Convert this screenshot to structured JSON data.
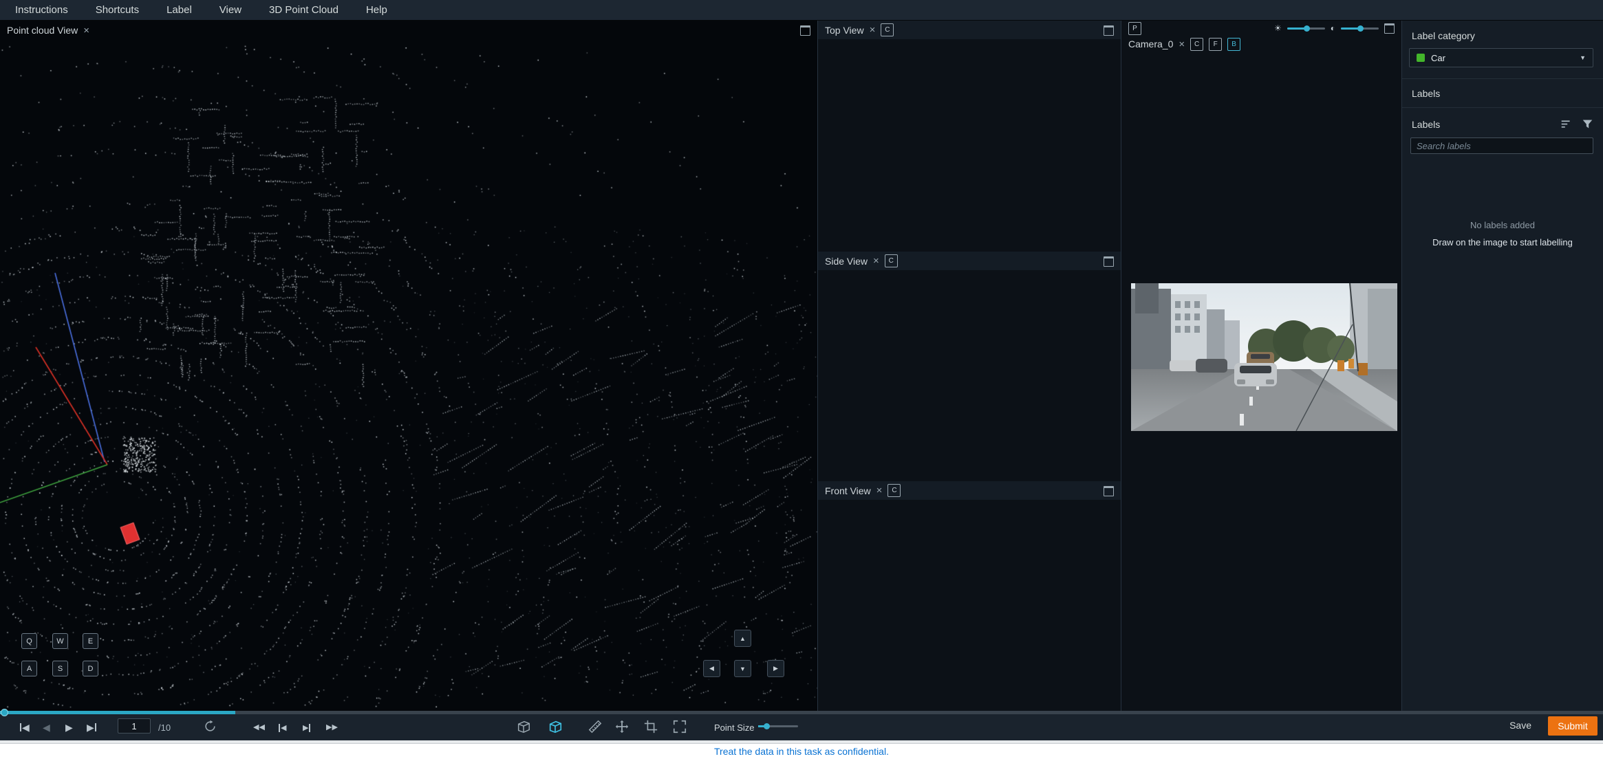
{
  "colors": {
    "accent_teal": "#36b1cf",
    "submit_orange": "#ec7211",
    "category_green": "#43b62b",
    "banner_blue": "#0972d3",
    "cuboid_red": "#e03131"
  },
  "menu": {
    "items": [
      "Instructions",
      "Shortcuts",
      "Label",
      "View",
      "3D Point Cloud",
      "Help"
    ]
  },
  "glyphs": {
    "close": "×",
    "caret_down": "▼",
    "play": "▶",
    "back": "◀",
    "forward": "▶",
    "up": "▲",
    "down": "▼",
    "left": "◀",
    "right": "▶",
    "brightness": "☀",
    "contrast": "◐"
  },
  "panels": {
    "point_cloud": {
      "title": "Point cloud View"
    },
    "top_view": {
      "title": "Top View",
      "camera_button": "C"
    },
    "side_view": {
      "title": "Side View",
      "camera_button": "C"
    },
    "front_view": {
      "title": "Front View",
      "camera_button": "C"
    },
    "camera": {
      "title": "Camera_0",
      "projection_button": "P",
      "buttons": {
        "c": "C",
        "f": "F",
        "b": "B"
      }
    }
  },
  "hotkeys": {
    "row1": [
      "Q",
      "W",
      "E"
    ],
    "row2": [
      "A",
      "S",
      "D"
    ]
  },
  "playback": {
    "current_frame": "1",
    "total_frames": "/10"
  },
  "toolbar": {
    "point_size_label": "Point Size"
  },
  "sidebar": {
    "label_category_heading": "Label category",
    "selected_category": "Car",
    "labels_heading": "Labels",
    "labels_list_heading": "Labels",
    "search_placeholder": "Search labels",
    "empty_state_title": "No labels added",
    "empty_state_subtitle": "Draw on the image to start labelling"
  },
  "actions": {
    "save": "Save",
    "submit": "Submit"
  },
  "banner": {
    "text": "Treat the data in this task as confidential."
  }
}
